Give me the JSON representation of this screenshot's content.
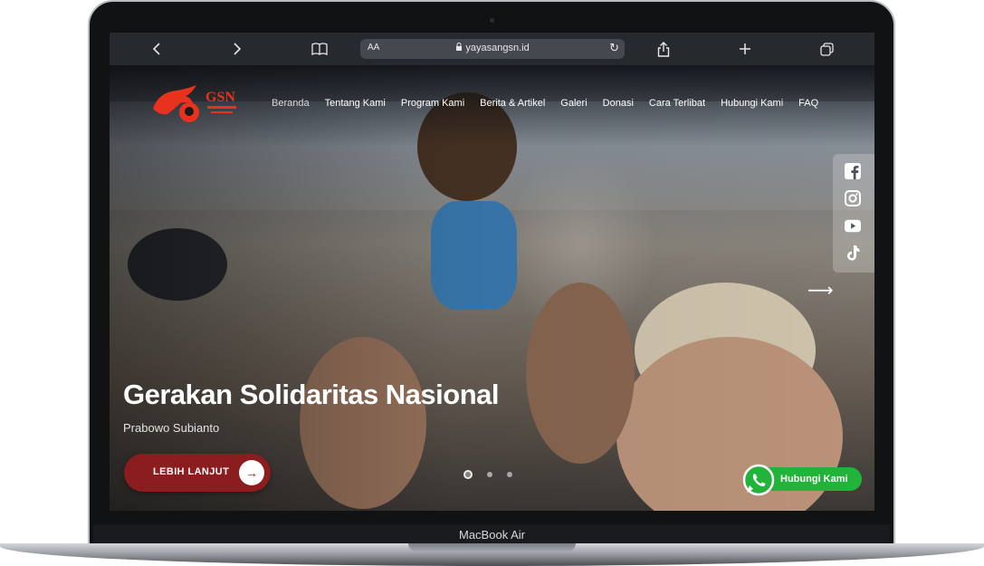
{
  "device": {
    "model_label": "MacBook Air"
  },
  "browser": {
    "text_size_label": "AA",
    "url": "yayasangsn.id",
    "icons": [
      "back-icon",
      "forward-icon",
      "bookmarks-icon",
      "lock-icon",
      "reload-icon",
      "share-icon",
      "new-tab-icon",
      "tabs-icon"
    ]
  },
  "site": {
    "logo_alt": "GSN",
    "nav": [
      {
        "label": "Beranda",
        "active": true
      },
      {
        "label": "Tentang Kami"
      },
      {
        "label": "Program Kami"
      },
      {
        "label": "Berita & Artikel"
      },
      {
        "label": "Galeri"
      },
      {
        "label": "Donasi"
      },
      {
        "label": "Cara Terlibat"
      },
      {
        "label": "Hubungi Kami"
      },
      {
        "label": "FAQ"
      }
    ],
    "social": [
      "facebook-icon",
      "instagram-icon",
      "youtube-icon",
      "tiktok-icon"
    ],
    "hero": {
      "title": "Gerakan Solidaritas Nasional",
      "subtitle": "Prabowo Subianto",
      "cta_label": "LEBIH LANJUT",
      "slides_total": 3,
      "active_slide": 1
    },
    "whatsapp": {
      "label": "Hubungi Kami"
    }
  },
  "colors": {
    "brand_red": "#8b1d1f",
    "logo_red": "#e8321e",
    "whatsapp_green": "#22b33a"
  }
}
